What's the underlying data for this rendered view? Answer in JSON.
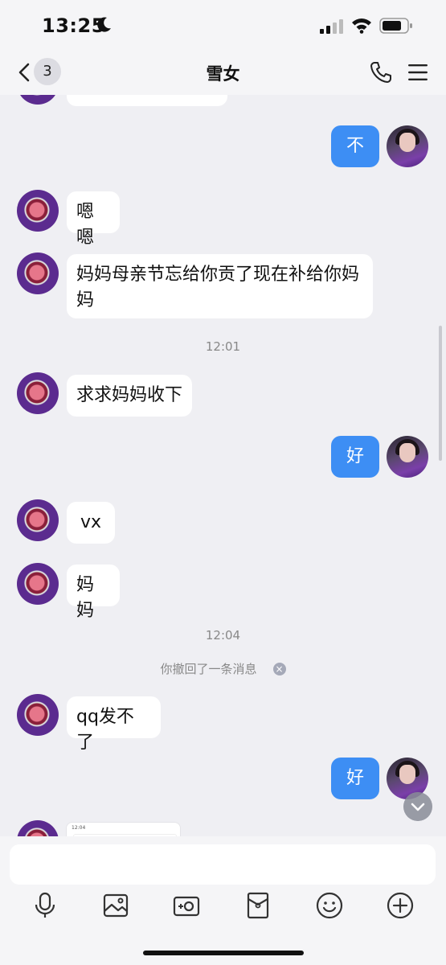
{
  "status": {
    "time": "13:25"
  },
  "nav": {
    "back_count": "3",
    "title": "雪女"
  },
  "messages": {
    "out1": "不",
    "in1": "嗯嗯",
    "in2": "妈妈母亲节忘给你贡了现在补给你妈妈",
    "ts1": "12:01",
    "in3": "求求妈妈收下",
    "out2": "好",
    "in4": "vx",
    "in5": "妈妈",
    "ts2": "12:04",
    "recall": "你撤回了一条消息",
    "in6": "qq发不了",
    "out3": "好",
    "thumb_status": "12:04"
  },
  "input": {
    "placeholder": ""
  },
  "colors": {
    "outgoing_bubble": "#3d8ef4",
    "background": "#efeff3"
  },
  "icons": {
    "status": [
      "moon-icon",
      "signal-icon",
      "wifi-icon",
      "battery-icon"
    ],
    "nav": [
      "back-chevron-icon",
      "phone-icon",
      "menu-icon"
    ],
    "toolbar": [
      "microphone-icon",
      "image-icon",
      "camera-icon",
      "red-packet-icon",
      "emoji-icon",
      "plus-icon"
    ]
  }
}
